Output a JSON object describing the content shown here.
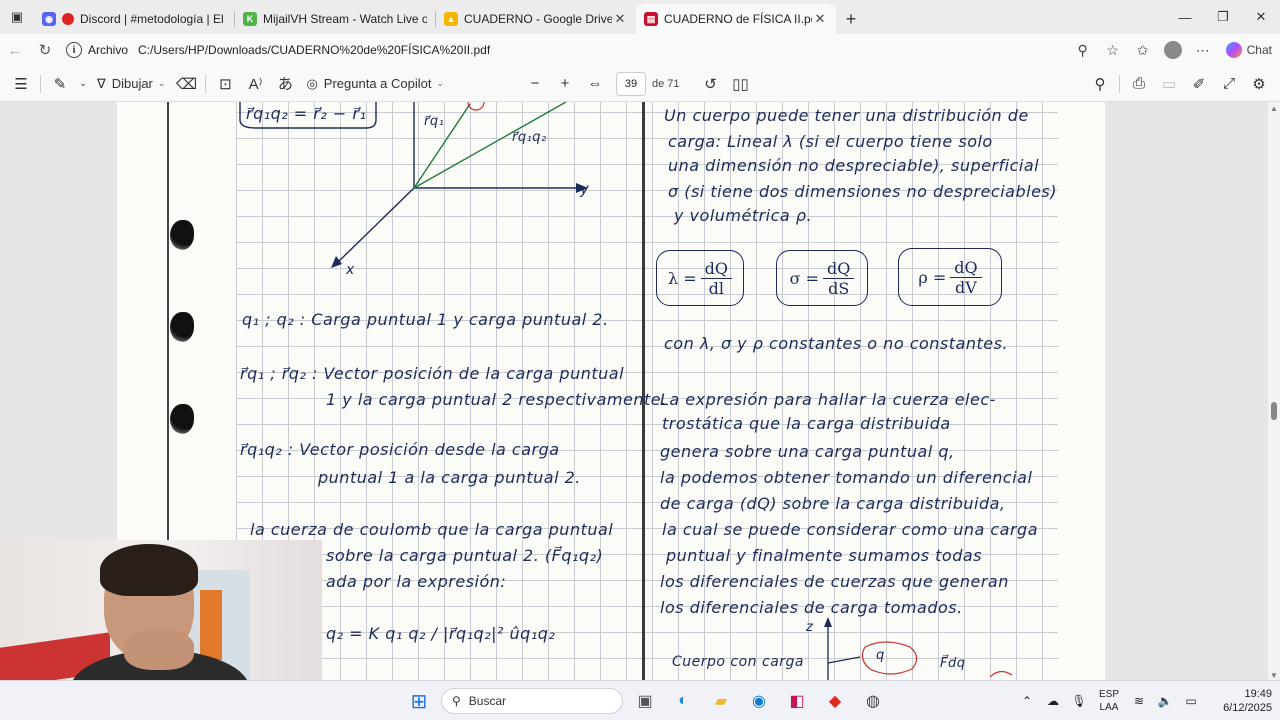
{
  "browser": {
    "tabs": [
      {
        "title": "Discord | #metodología | El se",
        "favicon_color": "#5865F2",
        "active": false
      },
      {
        "title": "MijailVH Stream - Watch Live on K",
        "favicon_color": "#53b348",
        "active": false
      },
      {
        "title": "CUADERNO - Google Drive",
        "favicon_color": "#f4b400",
        "active": false
      },
      {
        "title": "CUADERNO de FÍSICA II.pdf",
        "favicon_color": "#c8102e",
        "active": true
      }
    ],
    "address": {
      "scheme_label": "Archivo",
      "url": "C:/Users/HP/Downloads/CUADERNO%20de%20FÍSICA%20II.pdf"
    },
    "chat_label": "Chat"
  },
  "pdf_toolbar": {
    "draw_label": "Dibujar",
    "copilot_label": "Pregunta a Copilot",
    "page_current": "39",
    "page_total": "de 71"
  },
  "notes": {
    "left": {
      "eq_top": "r⃗q₁q₂ = r⃗₂ − r⃗₁",
      "label_rq1": "r⃗q₁",
      "label_rq1q2": "r⃗q₁q₂",
      "axis_y": "y",
      "axis_x": "x",
      "line1": "q₁ ; q₂ : Carga puntual 1 y carga puntual 2.",
      "line2a": "r⃗q₁ ; r⃗q₂ : Vector posición de la carga puntual",
      "line2b": "1 y la carga puntual 2 respectivamente.",
      "line3a": "r⃗q₁q₂ : Vector posición desde la carga",
      "line3b": "puntual 1 a la carga puntual 2.",
      "line4a": "la cuerza de coulomb que la carga puntual",
      "line4b": "sobre la carga puntual 2. (F⃗q₁q₂)",
      "line4c": "ada por la expresión:",
      "formula": "q₂ = K q₁ q₂ / |r⃗q₁q₂|²  ûq₁q₂"
    },
    "right": {
      "p1": "Un cuerpo puede tener una distribución de",
      "p2": "carga: Lineal λ (si el cuerpo tiene solo",
      "p3": "una dimensión no despreciable), superficial",
      "p4": "σ (si tiene dos dimensiones no despreciables)",
      "p5": "y volumétrica ρ.",
      "f1_lhs": "λ =",
      "f1_num": "dQ",
      "f1_den": "dl",
      "f2_lhs": "σ =",
      "f2_num": "dQ",
      "f2_den": "dS",
      "f3_lhs": "ρ =",
      "f3_num": "dQ",
      "f3_den": "dV",
      "c1": "con λ, σ y ρ  constantes o no constantes.",
      "q1": "La expresión para hallar la cuerza elec-",
      "q2": "trostática que la carga distribuida",
      "q3": "genera sobre una carga puntual q,",
      "q4": "la podemos obtener tomando un diferencial",
      "q5": "de carga (dQ) sobre la carga distribuida,",
      "q6": "la cual se puede considerar como una carga",
      "q7": "puntual y finalmente sumamos todas",
      "q8": "los diferenciales de cuerzas que generan",
      "q9": "los diferenciales de carga tomados.",
      "fig_label": "Cuerpo con carga",
      "fig_z": "z",
      "fig_q": "q",
      "fig_dF": "F⃗dq"
    }
  },
  "taskbar": {
    "search_placeholder": "Buscar",
    "lang_line1": "ESP",
    "lang_line2": "LAA",
    "time": "19:49",
    "date": "6/12/2025"
  }
}
